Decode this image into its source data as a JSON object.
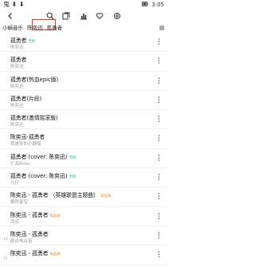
{
  "status": {
    "left": "鬼 ⬇ ⬇",
    "battery_icon": "battery-icon",
    "time": "3:05"
  },
  "tabs": {
    "items": [
      "小蜗音乐",
      "陈奕迅",
      "孤勇者"
    ]
  },
  "rows": [
    {
      "title": "孤勇者",
      "tag": "无损",
      "tag_color": "green",
      "sub": "陈奕迅",
      "num": ""
    },
    {
      "title": "孤勇者",
      "tag": "",
      "sub": "陈奕迅",
      "num": ""
    },
    {
      "title": "孤勇者(热血epic版)",
      "tag": "",
      "sub": "陈奕迅",
      "num": ""
    },
    {
      "title": "孤勇者(片段)",
      "tag": "",
      "sub": "陈奕迅",
      "num": ""
    },
    {
      "title": "孤勇者(激情摇滚版)",
      "tag": "",
      "sub": "陈奕迅",
      "num": ""
    },
    {
      "title": "陈奕迅-孤勇者",
      "tag": "",
      "sub": "我是你的小翻唱",
      "num": ""
    },
    {
      "title": "孤勇者 (cover: 陈奕迅)",
      "tag": "无损",
      "tag_color": "green",
      "sub": "仁海Aries",
      "num": ""
    },
    {
      "title": "孤勇者 (cover: 陈奕迅)",
      "tag": "无损",
      "tag_color": "green",
      "sub": "凡仔",
      "num": ""
    },
    {
      "title": "陈奕迅 - 孤勇者 （英雄联盟主题曲）",
      "tag": "高品质",
      "tag_color": "orange",
      "sub": "懒然星空",
      "num": ""
    },
    {
      "title": "陈奕迅 - 孤勇者",
      "tag": "高品质",
      "tag_color": "orange",
      "sub": "凉谈",
      "num": ""
    },
    {
      "title": "陈奕迅 - 孤勇者",
      "tag": "",
      "sub": "联合电台音",
      "num": "10"
    },
    {
      "title": "陈奕迅 - 孤勇者",
      "tag": "高品质",
      "tag_color": "orange",
      "sub": "",
      "num": "11"
    }
  ]
}
